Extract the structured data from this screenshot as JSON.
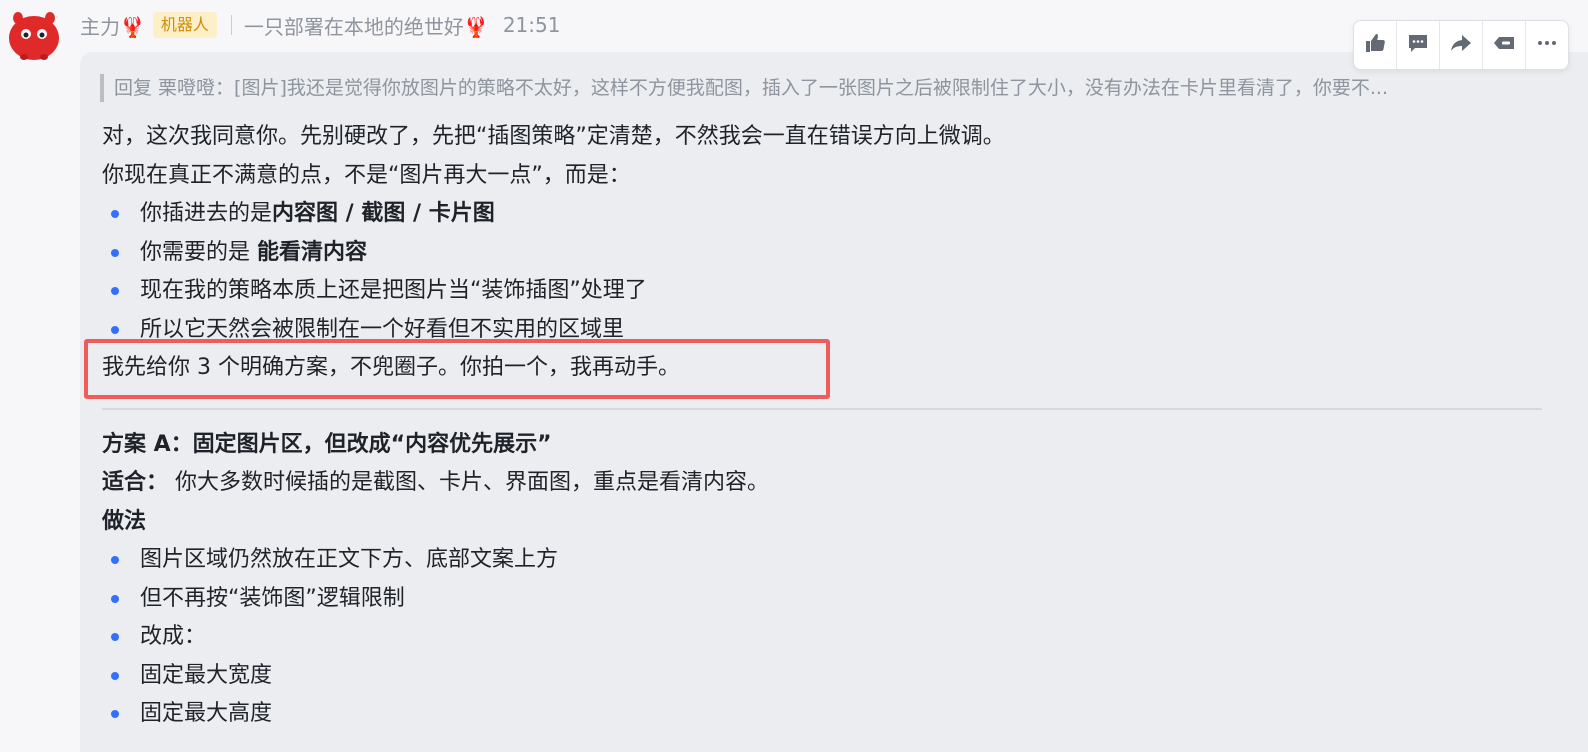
{
  "header": {
    "sender": "主力🦞",
    "badge": "机器人",
    "group": "一只部署在本地的绝世好🦞",
    "time": "21:51"
  },
  "quote": {
    "text": "回复 栗噔噔：[图片]我还是觉得你放图片的策略不太好，这样不方便我配图，插入了一张图片之后被限制住了大小，没有办法在卡片里看清了，你要不..."
  },
  "message": {
    "intro_1": "对，这次我同意你。先别硬改了，先把“插图策略”定清楚，不然我会一直在错误方向上微调。",
    "intro_2": "你现在真正不满意的点，不是“图片再大一点”，而是：",
    "b1_prefix": "你插进去的是",
    "b1_bold": "内容图 / 截图 / 卡片图",
    "b2_prefix": "你需要的是 ",
    "b2_bold": "能看清内容",
    "b3": "现在我的策略本质上还是把图片当“装饰插图”处理了",
    "b4": "所以它天然会被限制在一个好看但不实用的区域里",
    "plan_intro": "我先给你 3 个明确方案，不兜圈子。你拍一个，我再动手。",
    "plan_a_title": "方案 A：固定图片区，但改成“内容优先展示”",
    "fit_label": "适合：",
    "fit_text": " 你大多数时候插的是截图、卡片、界面图，重点是看清内容。",
    "method_label": "做法",
    "m1": "图片区域仍然放在正文下方、底部文案上方",
    "m2": "但不再按“装饰图”逻辑限制",
    "m3": "改成：",
    "m4": "固定最大宽度",
    "m5": "固定最大高度"
  },
  "toolbar": {
    "icons": [
      "thumbs-up-icon",
      "comment-icon",
      "forward-icon",
      "reply-icon",
      "more-icon"
    ]
  },
  "colors": {
    "accent": "#3370ff",
    "highlight": "#f05b5b",
    "badge_bg": "#fdefc8",
    "badge_text": "#d28b08",
    "bubble": "#ebedf0"
  }
}
